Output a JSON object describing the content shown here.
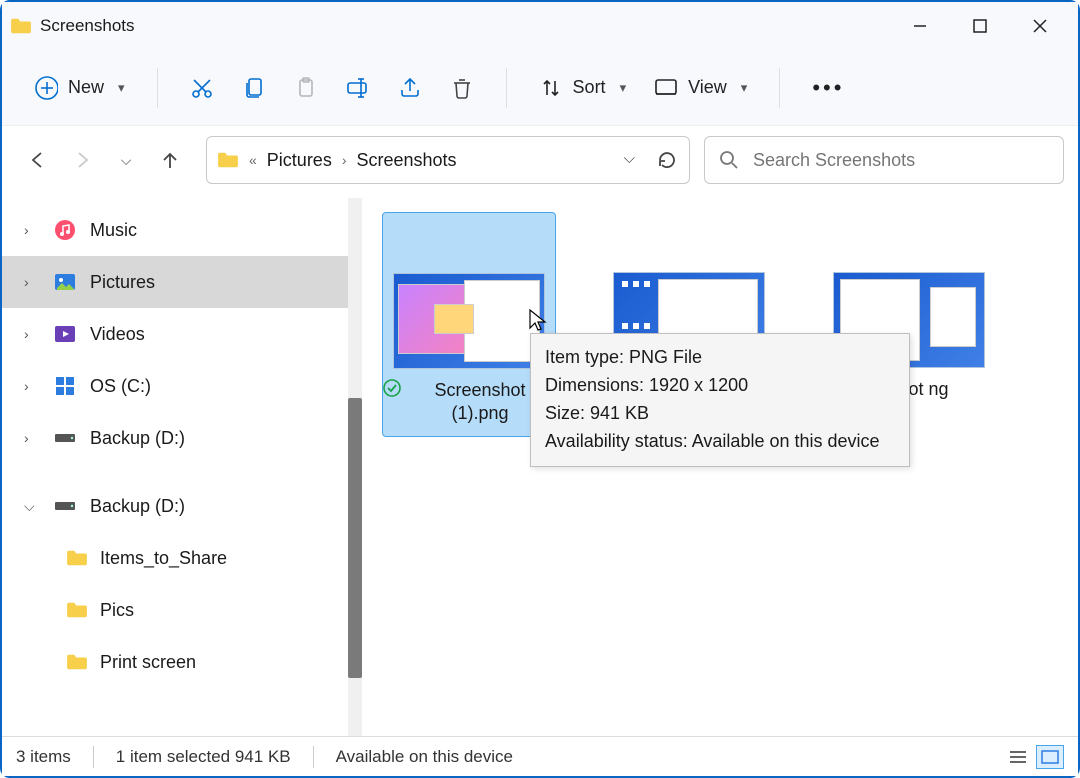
{
  "window": {
    "title": "Screenshots"
  },
  "toolbar": {
    "new_label": "New",
    "sort_label": "Sort",
    "view_label": "View"
  },
  "breadcrumb": {
    "parent": "Pictures",
    "current": "Screenshots"
  },
  "search": {
    "placeholder": "Search Screenshots"
  },
  "sidebar": {
    "items": [
      {
        "label": "Music",
        "icon": "music-icon",
        "expanded": false
      },
      {
        "label": "Pictures",
        "icon": "pictures-icon",
        "expanded": false,
        "selected": true
      },
      {
        "label": "Videos",
        "icon": "videos-icon",
        "expanded": false
      },
      {
        "label": "OS (C:)",
        "icon": "os-drive-icon",
        "expanded": false
      },
      {
        "label": "Backup (D:)",
        "icon": "drive-icon",
        "expanded": false
      }
    ],
    "group": {
      "label": "Backup (D:)",
      "icon": "drive-icon",
      "children": [
        {
          "label": "Items_to_Share"
        },
        {
          "label": "Pics"
        },
        {
          "label": "Print screen"
        }
      ]
    }
  },
  "files": [
    {
      "name": "Screenshot (1).png",
      "selected": true,
      "synced": true
    },
    {
      "name": "",
      "selected": false
    },
    {
      "name": "enshot ng",
      "selected": false
    }
  ],
  "tooltip": {
    "line1": "Item type: PNG File",
    "line2": "Dimensions: 1920 x 1200",
    "line3": "Size: 941 KB",
    "line4": "Availability status: Available on this device"
  },
  "status": {
    "count": "3 items",
    "selected": "1 item selected  941 KB",
    "availability": "Available on this device"
  }
}
